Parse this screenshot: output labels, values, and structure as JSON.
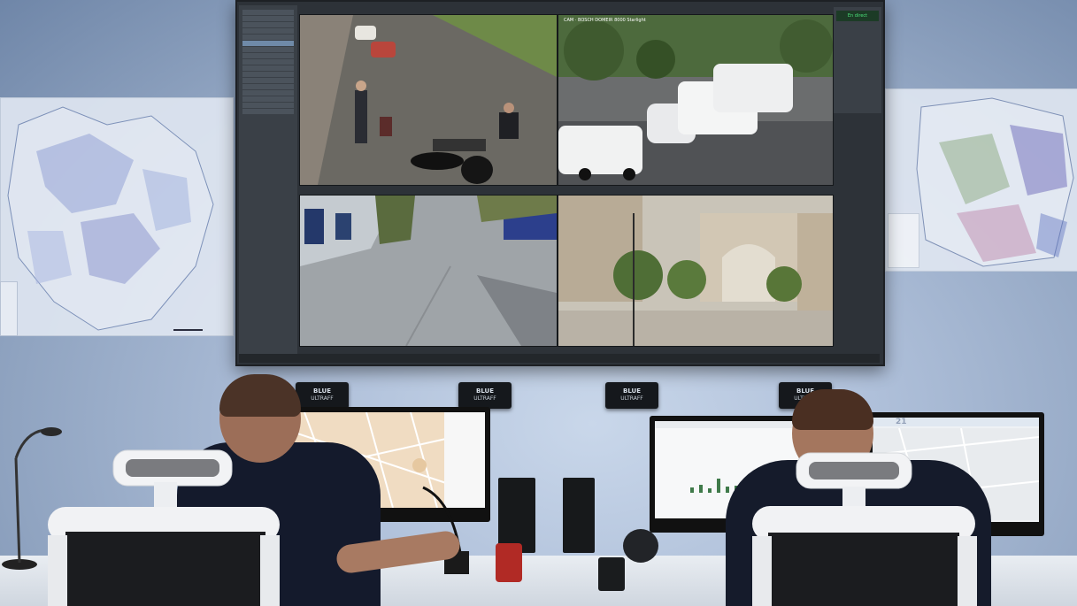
{
  "scene": {
    "description_label": "",
    "video_wall": {
      "sidebar_tabs": [
        "",
        ""
      ],
      "feeds": [
        {
          "label": ""
        },
        {
          "label": "CAM · BOSCH DOMEIR 8000 Starlight"
        },
        {
          "label": ""
        },
        {
          "label": ""
        }
      ],
      "live_badge": "En direct",
      "bottom_bar": [
        "",
        "",
        "",
        "",
        "",
        ""
      ]
    },
    "decoders": [
      {
        "brand": "BLUE",
        "model": "ULTRAFF"
      },
      {
        "brand": "BLUE",
        "model": "ULTRAFF"
      },
      {
        "brand": "BLUE",
        "model": "ULTRAFF"
      },
      {
        "brand": "BLUE",
        "model": "ULTRAFF"
      }
    ],
    "monitors": {
      "right_weather": "21"
    }
  },
  "colors": {
    "wall_blue": "#aebfd9",
    "feed_green": "#4be27a",
    "desk": "#e9edf2"
  }
}
